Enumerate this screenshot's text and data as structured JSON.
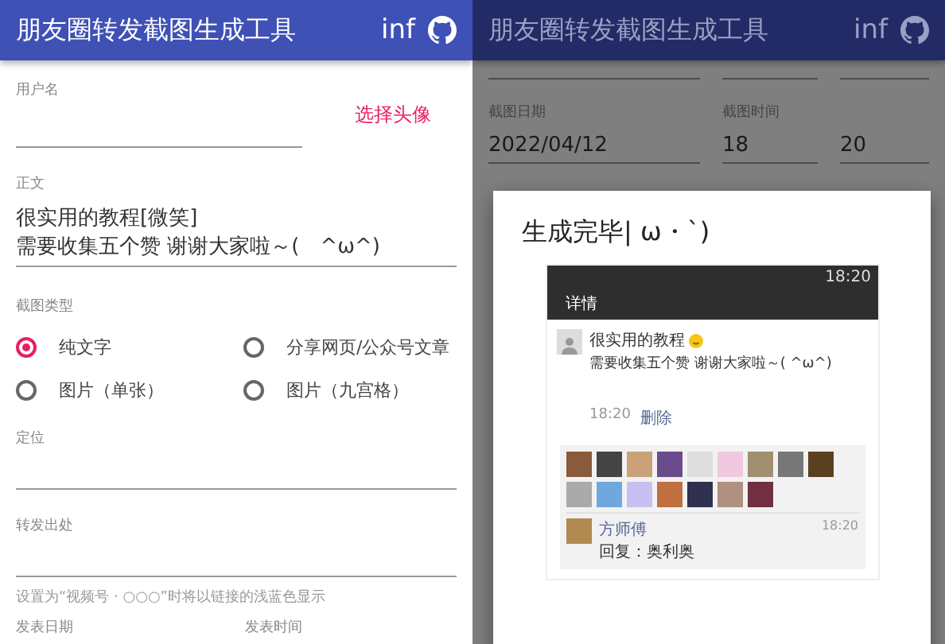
{
  "form_panel": {
    "app_bar": {
      "title": "朋友圈转发截图生成工具",
      "info": "inf"
    },
    "username": {
      "label": "用户名"
    },
    "avatar_button": "选择头像",
    "body": {
      "label": "正文",
      "lines": [
        "很实用的教程[微笑]",
        "需要收集五个赞 谢谢大家啦～(　^ω^)"
      ]
    },
    "screenshot_type": {
      "label": "截图类型",
      "options": [
        {
          "label": "纯文字",
          "selected": true
        },
        {
          "label": "分享网页/公众号文章",
          "selected": false
        },
        {
          "label": "图片（单张）",
          "selected": false
        },
        {
          "label": "图片（九宫格）",
          "selected": false
        }
      ]
    },
    "location": {
      "label": "定位"
    },
    "source": {
      "label": "转发出处",
      "helper": "设置为“视频号 · ○○○”时将以链接的浅蓝色显示"
    },
    "publish": {
      "date_label": "发表日期",
      "time_label": "发表时间"
    }
  },
  "result_panel": {
    "app_bar": {
      "title": "朋友圈转发截图生成工具",
      "info": "inf"
    },
    "capture": {
      "date_label": "截图日期",
      "date": "2022/04/12",
      "time_label": "截图时间",
      "hour": "18",
      "minute": "20"
    },
    "dialog": {
      "title": "生成完毕| ω・`)",
      "preview": {
        "status_time": "18:20",
        "header": "详情",
        "post_lines": [
          "很实用的教程",
          "需要收集五个赞 谢谢大家啦～( ^ω^)"
        ],
        "post_time": "18:20",
        "delete": "删除",
        "comment": {
          "name": "方师傅",
          "time": "18:20",
          "text": "回复：奥利奥"
        }
      }
    }
  }
}
